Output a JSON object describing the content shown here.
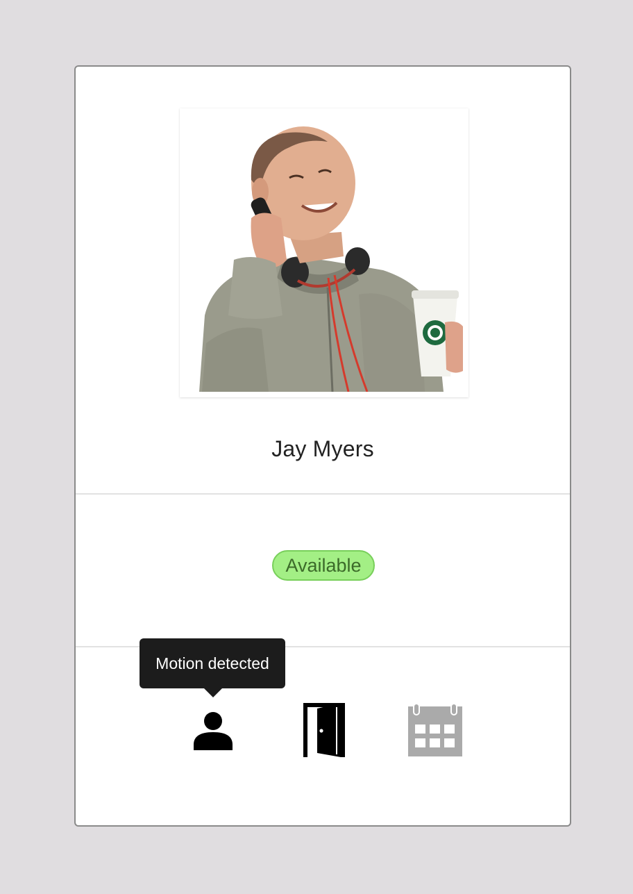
{
  "profile": {
    "name": "Jay Myers",
    "photo_alt": "Photo of Jay Myers"
  },
  "status": {
    "label": "Available",
    "color": "#a3ef85",
    "border_color": "#78cf5a",
    "text_color": "#3c6b2a"
  },
  "sensors": {
    "tooltip": "Motion detected",
    "items": [
      {
        "icon": "person-icon",
        "state": "active",
        "color": "#000000"
      },
      {
        "icon": "door-icon",
        "state": "open",
        "color": "#000000"
      },
      {
        "icon": "calendar-icon",
        "state": "inactive",
        "color": "#aaaaaa"
      }
    ]
  }
}
